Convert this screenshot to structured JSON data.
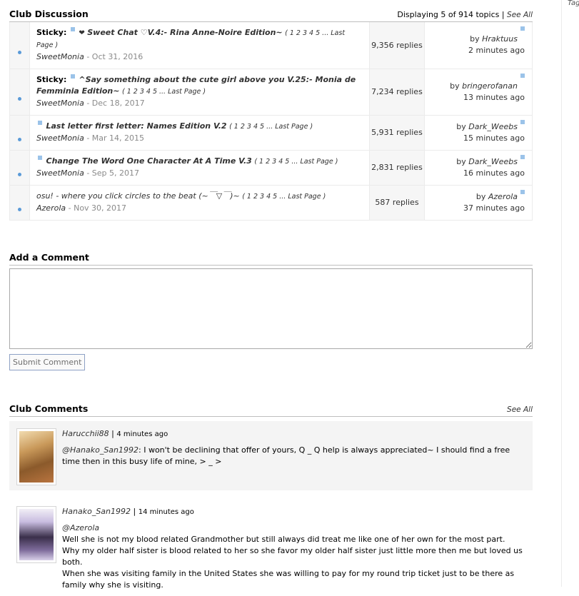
{
  "right_column": {
    "tag": "Tag"
  },
  "club_discussion": {
    "title": "Club Discussion",
    "displaying": "Displaying 5 of 914 topics |",
    "see_all": "See All",
    "topics": [
      {
        "sticky": "Sticky:",
        "title": "Sweet Chat ♡V.4:- Rina Anne-Noire Edition~",
        "pages": "( 1 2 3 4 5 ... Last Page )",
        "author": "SweetMonia",
        "date": "Oct 31, 2016",
        "replies": "9,356 replies",
        "by": "by",
        "last_user": "Hraktuus",
        "last_time": "2 minutes ago"
      },
      {
        "sticky": "Sticky:",
        "title": "^Say something about the cute girl above you V.25:- Monia de Femminia Edition~",
        "pages": "( 1 2 3 4 5 ... Last Page )",
        "author": "SweetMonia",
        "date": "Dec 18, 2017",
        "replies": "7,234 replies",
        "by": "by",
        "last_user": "bringerofanan",
        "last_time": "13 minutes ago"
      },
      {
        "sticky": "",
        "title": "Last letter first letter: Names Edition V.2",
        "pages": "( 1 2 3 4 5 ... Last Page )",
        "author": "SweetMonia",
        "date": "Mar 14, 2015",
        "replies": "5,931 replies",
        "by": "by",
        "last_user": "Dark_Weebs",
        "last_time": "15 minutes ago"
      },
      {
        "sticky": "",
        "title": "Change The Word One Character At A Time V.3",
        "pages": "( 1 2 3 4 5 ... Last Page )",
        "author": "SweetMonia",
        "date": "Sep 5, 2017",
        "replies": "2,831 replies",
        "by": "by",
        "last_user": "Dark_Weebs",
        "last_time": "16 minutes ago"
      },
      {
        "sticky": "",
        "title": "osu! - where you click circles to the beat (~￣▽￣)~",
        "pages": "( 1 2 3 4 5 ... Last Page )",
        "author": "Azerola",
        "date": "Nov 30, 2017",
        "replies": "587 replies",
        "by": "by",
        "last_user": "Azerola",
        "last_time": "37 minutes ago"
      }
    ]
  },
  "add_comment": {
    "title": "Add a Comment",
    "textarea_value": "",
    "submit_label": "Submit Comment"
  },
  "club_comments": {
    "title": "Club Comments",
    "see_all": "See All",
    "comments": [
      {
        "user": "Harucchii88",
        "separator": " | ",
        "time": "4 minutes ago",
        "mention": "@Hanako_San1992",
        "lines": [
          ": I won't be declining that offer of yours, Q _ Q help is always appreciated~ I should find a free time then in this busy life of mine, > _ >"
        ]
      },
      {
        "user": "Hanako_San1992",
        "separator": " | ",
        "time": "14 minutes ago",
        "mention": "@Azerola",
        "lines": [
          "Well she is not my blood related Grandmother but still always did treat me like one of her own for the most part.",
          "Why my older half sister is blood related to her so she favor my older half sister just little more then me but loved us both.",
          "When she was visiting family in the United States she was willing to pay for my round trip ticket just to be there as family why she is visiting."
        ]
      }
    ]
  },
  "colors": {
    "link": "#1d439b",
    "bullet": "#5a9ad8",
    "new_marker": "#9bc3e9",
    "date_grey": "#8a8a8a"
  },
  "icons": {
    "bullet": "unread-dot-icon",
    "new_marker": "new-post-square-icon",
    "heart": "heart-icon"
  }
}
